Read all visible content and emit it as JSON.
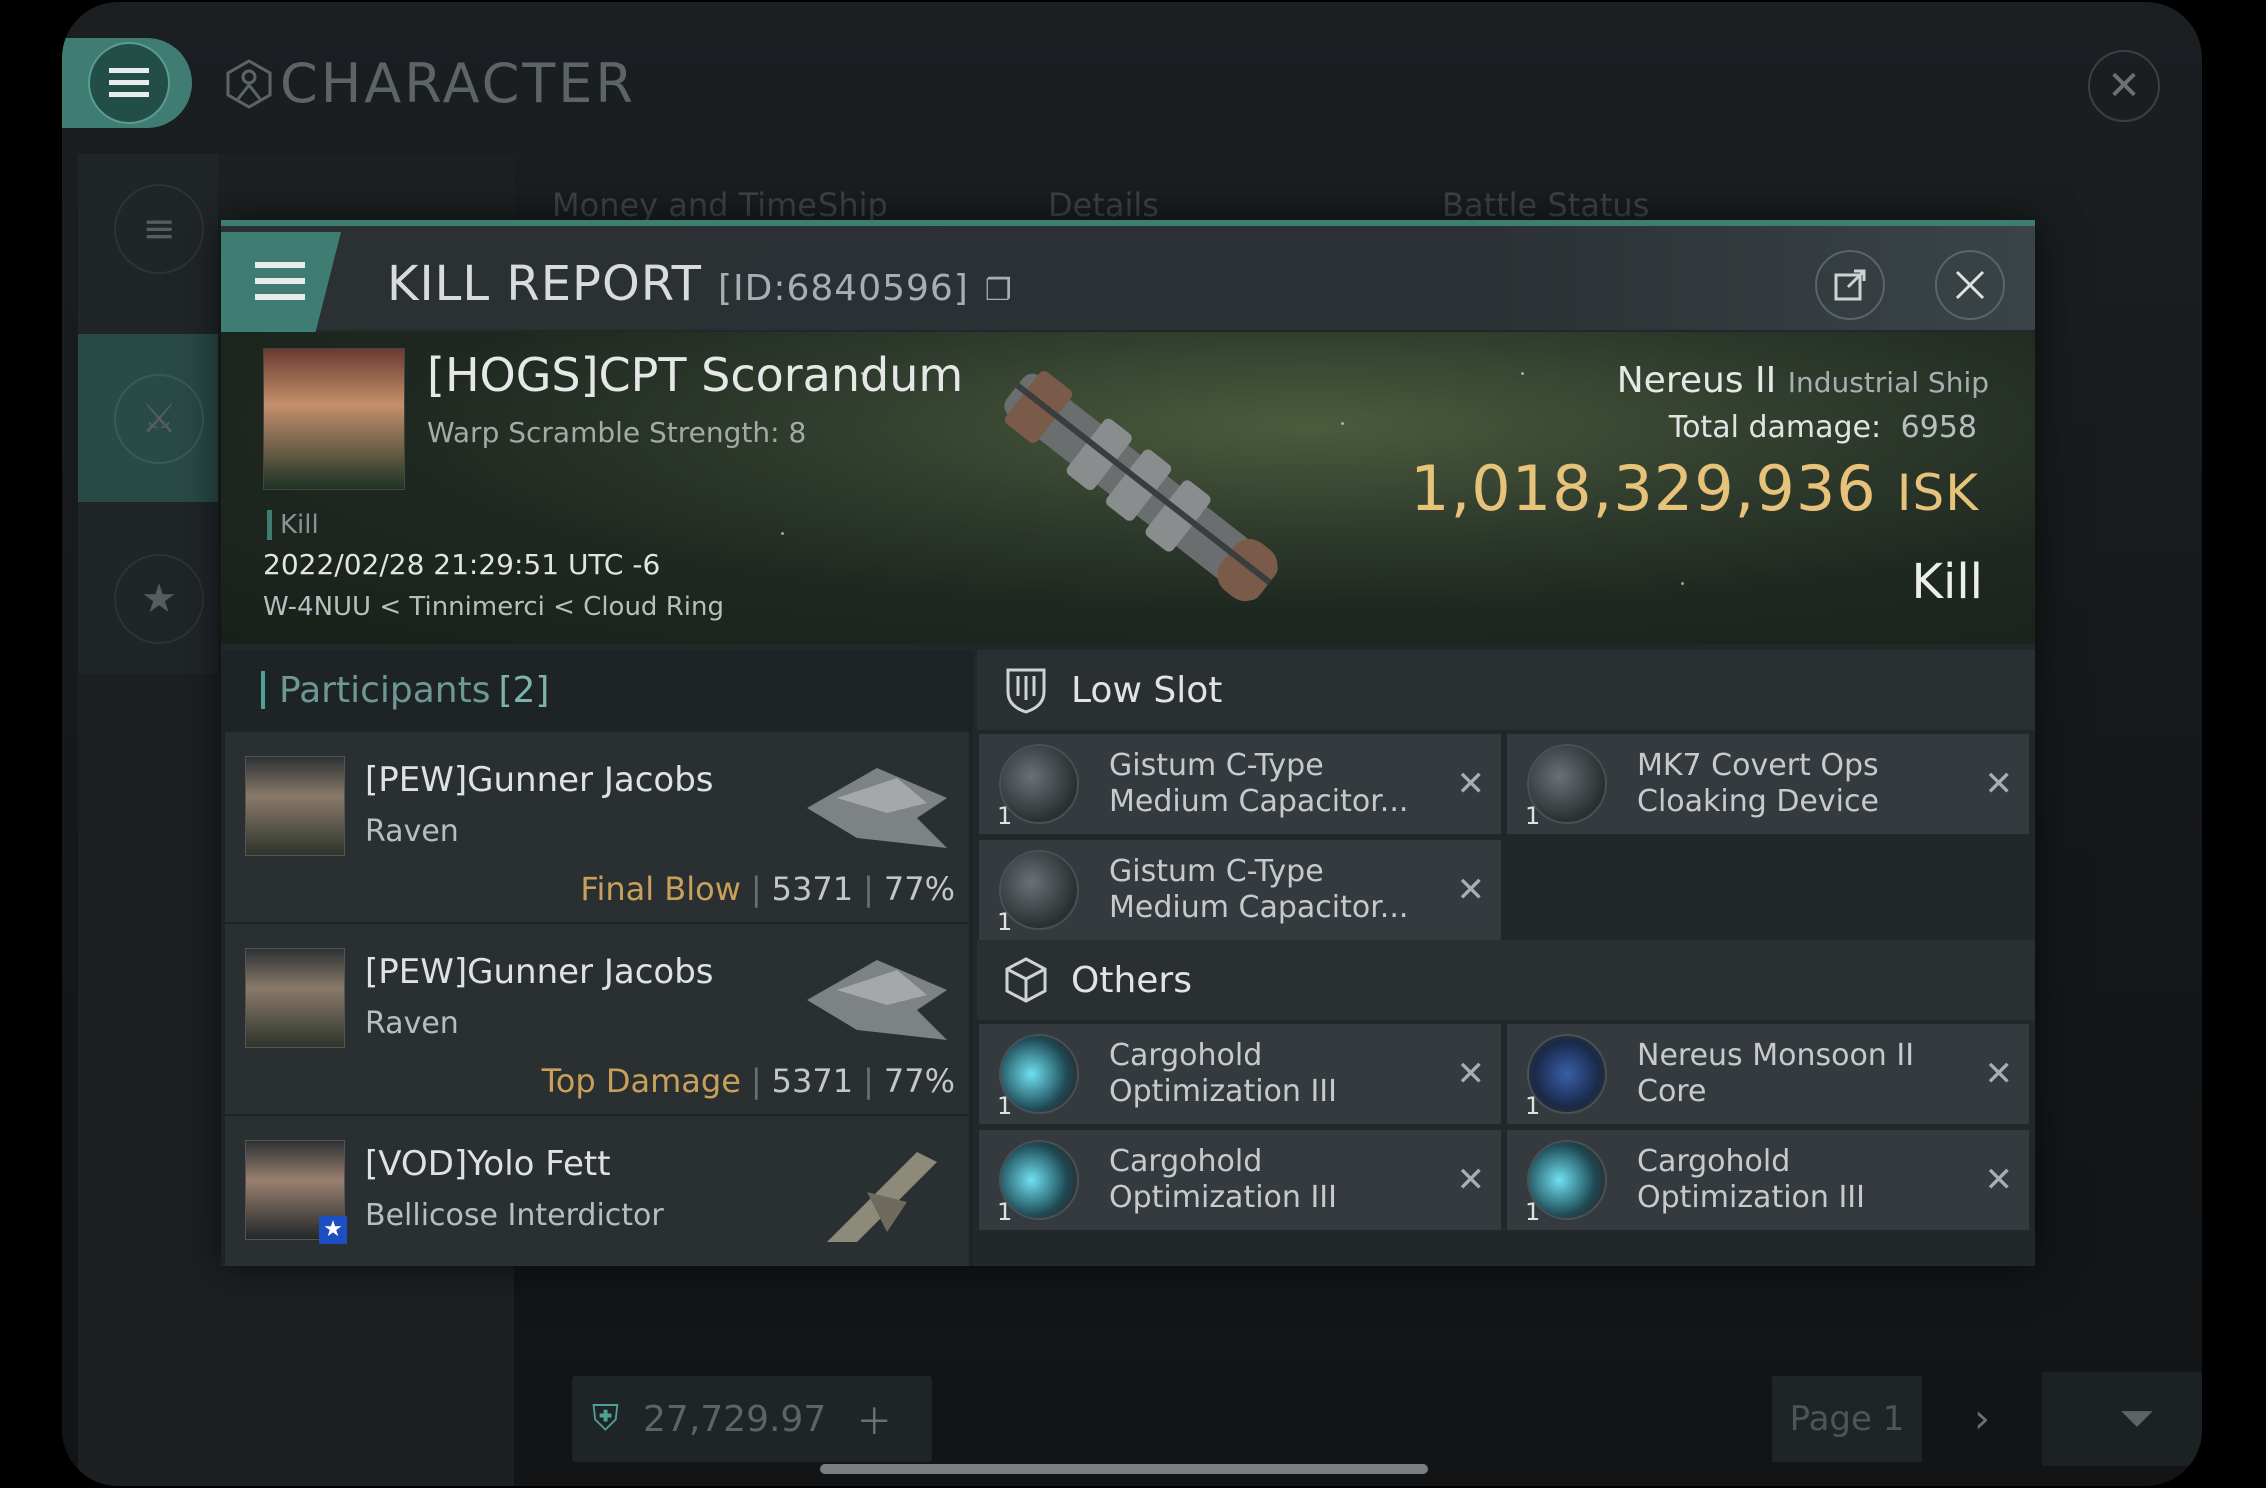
{
  "background": {
    "title": "CHARACTER",
    "tabs": [
      "Money and Time",
      "Ship",
      "Details",
      "Battle Status"
    ],
    "wallet": "27,729.97",
    "page": "Page 1",
    "close_icon": "close-icon"
  },
  "modal": {
    "title": "KILL REPORT",
    "id": "[ID:6840596]",
    "victim": {
      "name": "[HOGS]CPT Scorandum",
      "warp": "Warp Scramble Strength: 8",
      "kill_tag": "Kill",
      "date": "2022/02/28 21:29:51 UTC -6",
      "location": "W-4NUU < Tinnimerci < Cloud Ring",
      "ship": "Nereus II",
      "ship_class": "Industrial Ship",
      "damage_label": "Total damage:",
      "damage": "6958",
      "isk": "1,018,329,936",
      "isk_unit": "ISK",
      "result": "Kill"
    },
    "participants": {
      "label": "Participants",
      "count": "[2]",
      "items": [
        {
          "name": "[PEW]Gunner Jacobs",
          "ship": "Raven",
          "tag": "Final Blow",
          "damage": "5371",
          "pct": "77%"
        },
        {
          "name": "[PEW]Gunner Jacobs",
          "ship": "Raven",
          "tag": "Top Damage",
          "damage": "5371",
          "pct": "77%"
        },
        {
          "name": "[VOD]Yolo Fett",
          "ship": "Bellicose Interdictor"
        }
      ]
    },
    "low_slot": {
      "label": "Low Slot",
      "items": [
        {
          "qty": "1",
          "line1": "Gistum C-Type",
          "line2": "Medium Capacitor..."
        },
        {
          "qty": "1",
          "line1": "MK7 Covert Ops",
          "line2": "Cloaking Device"
        },
        {
          "qty": "1",
          "line1": "Gistum C-Type",
          "line2": "Medium Capacitor..."
        }
      ]
    },
    "others": {
      "label": "Others",
      "items": [
        {
          "qty": "1",
          "line1": "Cargohold",
          "line2": "Optimization III"
        },
        {
          "qty": "1",
          "line1": "Nereus Monsoon II",
          "line2": "Core"
        },
        {
          "qty": "1",
          "line1": "Cargohold",
          "line2": "Optimization III"
        },
        {
          "qty": "1",
          "line1": "Cargohold",
          "line2": "Optimization III"
        }
      ]
    }
  }
}
